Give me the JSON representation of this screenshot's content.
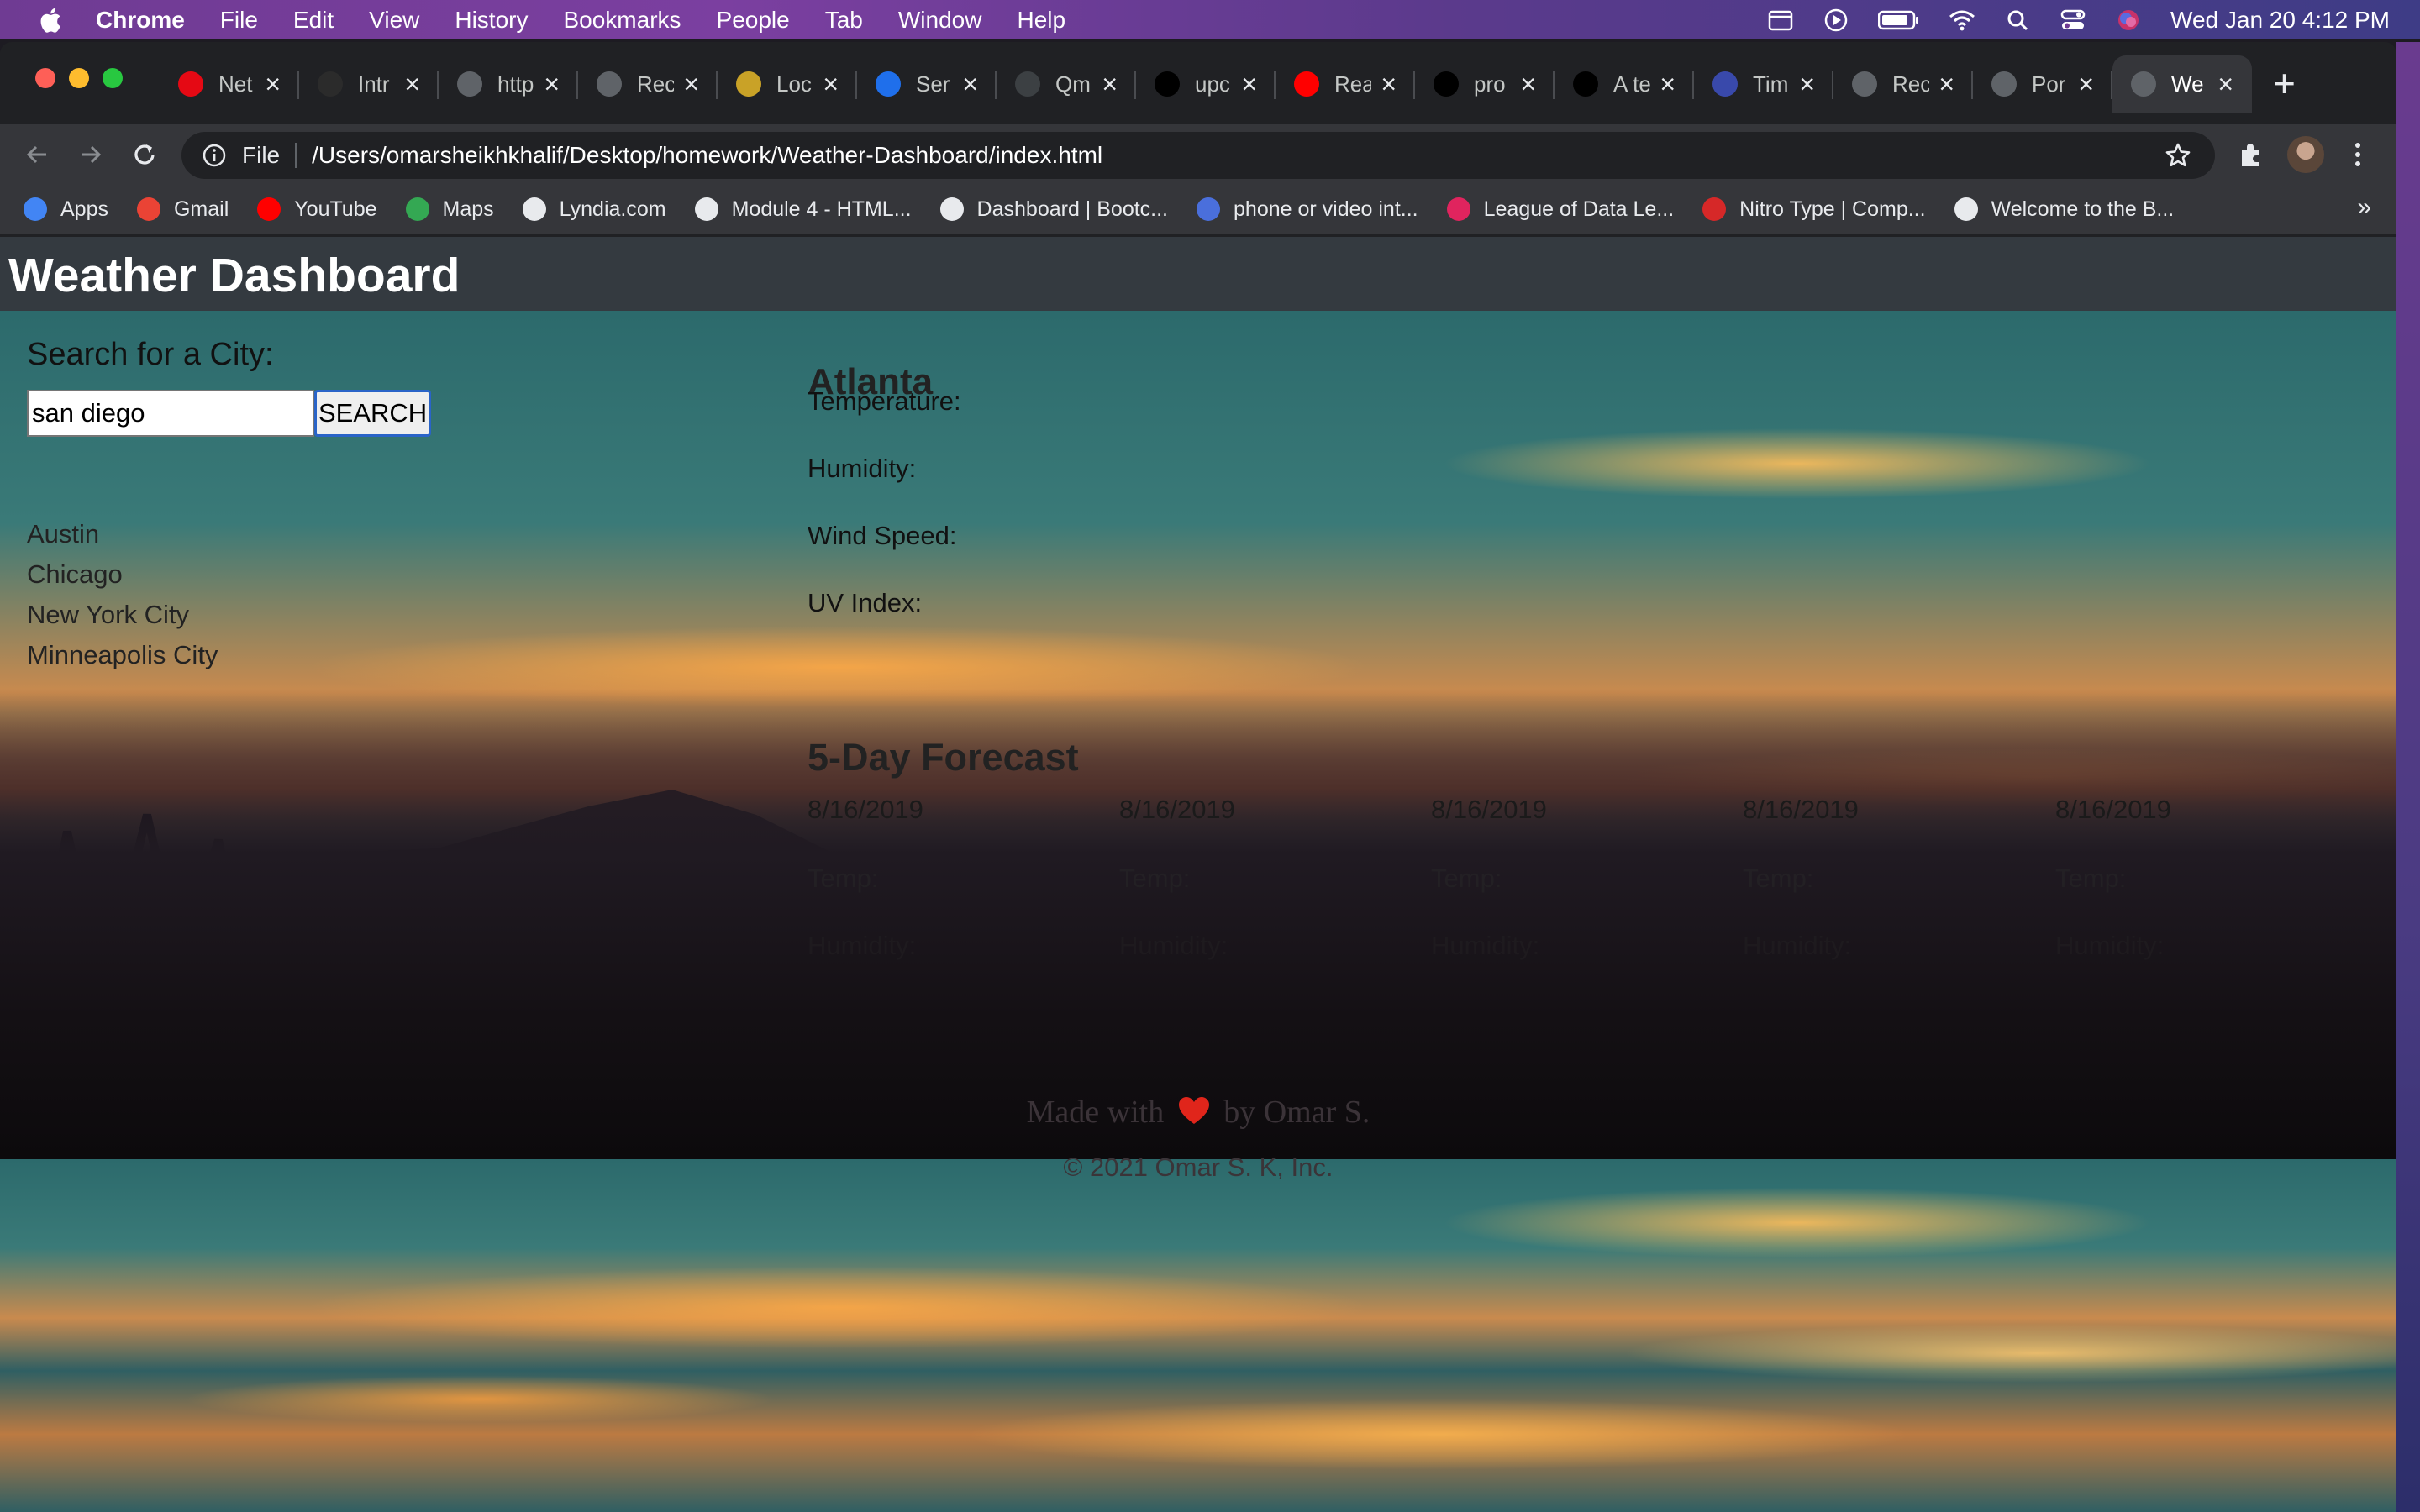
{
  "menubar": {
    "app_name": "Chrome",
    "items": [
      "File",
      "Edit",
      "View",
      "History",
      "Bookmarks",
      "People",
      "Tab",
      "Window",
      "Help"
    ],
    "clock": "Wed Jan 20  4:12 PM",
    "status_icons": [
      "calendar-icon",
      "play-icon",
      "battery-icon",
      "wifi-icon",
      "spotlight-icon",
      "control-center-icon",
      "siri-icon"
    ]
  },
  "tabs": [
    {
      "title": "Net",
      "icon": "netflix-icon",
      "color": "#e50914"
    },
    {
      "title": "Intr",
      "icon": "cs-icon",
      "color": "#2b2b2b"
    },
    {
      "title": "http",
      "icon": "globe-icon",
      "color": "#5f6368"
    },
    {
      "title": "Rec",
      "icon": "globe-icon",
      "color": "#5f6368"
    },
    {
      "title": "Loc",
      "icon": "badge-icon",
      "color": "#c9a227"
    },
    {
      "title": "Ser",
      "icon": "h-icon",
      "color": "#1f6feb"
    },
    {
      "title": "Qm",
      "icon": "q-icon",
      "color": "#3c4043"
    },
    {
      "title": "upc",
      "icon": "github-icon",
      "color": "#000000"
    },
    {
      "title": "Rea",
      "icon": "youtube-icon",
      "color": "#ff0000"
    },
    {
      "title": "pro",
      "icon": "github-icon",
      "color": "#000000"
    },
    {
      "title": "A te",
      "icon": "github-icon",
      "color": "#000000"
    },
    {
      "title": "Tim",
      "icon": "octo-icon",
      "color": "#3949ab"
    },
    {
      "title": "Rec",
      "icon": "globe-icon",
      "color": "#5f6368"
    },
    {
      "title": "Por",
      "icon": "globe-icon",
      "color": "#5f6368"
    },
    {
      "title": "We",
      "icon": "globe-icon",
      "color": "#5f6368",
      "active": true
    }
  ],
  "toolbar": {
    "scheme": "File",
    "url": "/Users/omarsheikhkhalif/Desktop/homework/Weather-Dashboard/index.html"
  },
  "bookmarks": [
    {
      "label": "Apps",
      "icon": "apps-grid-icon",
      "color": "#4285f4"
    },
    {
      "label": "Gmail",
      "icon": "gmail-icon",
      "color": "#ea4335"
    },
    {
      "label": "YouTube",
      "icon": "youtube-icon",
      "color": "#ff0000"
    },
    {
      "label": "Maps",
      "icon": "maps-icon",
      "color": "#34a853"
    },
    {
      "label": "Lyndia.com",
      "icon": "globe-icon",
      "color": "#e8eaed"
    },
    {
      "label": "Module 4 - HTML...",
      "icon": "page-icon",
      "color": "#e8eaed"
    },
    {
      "label": "Dashboard | Bootc...",
      "icon": "globe-icon",
      "color": "#e8eaed"
    },
    {
      "label": "phone or video int...",
      "icon": "video-icon",
      "color": "#4a6fdc"
    },
    {
      "label": "League of Data Le...",
      "icon": "m-logo-icon",
      "color": "#e0245e"
    },
    {
      "label": "Nitro Type | Comp...",
      "icon": "nitro-icon",
      "color": "#d62828"
    },
    {
      "label": "Welcome to the B...",
      "icon": "page-icon",
      "color": "#e8eaed"
    }
  ],
  "page": {
    "title": "Weather Dashboard",
    "search": {
      "label": "Search for a City:",
      "value": "san diego",
      "button": "SEARCH"
    },
    "cities": [
      "Austin",
      "Chicago",
      "New York City",
      "Minneapolis City"
    ],
    "current": {
      "city": "Atlanta",
      "temperature_label": "Temperature:",
      "humidity_label": "Humidity:",
      "wind_label": "Wind Speed:",
      "uv_label": "UV Index:"
    },
    "forecast": {
      "title": "5-Day Forecast",
      "days": [
        {
          "date": "8/16/2019",
          "temp": "Temp:",
          "humidity": "Humidity:"
        },
        {
          "date": "8/16/2019",
          "temp": "Temp:",
          "humidity": "Humidity:"
        },
        {
          "date": "8/16/2019",
          "temp": "Temp:",
          "humidity": "Humidity:"
        },
        {
          "date": "8/16/2019",
          "temp": "Temp:",
          "humidity": "Humidity:"
        },
        {
          "date": "8/16/2019",
          "temp": "Temp:",
          "humidity": "Humidity:"
        }
      ]
    },
    "footer": {
      "made_with": "Made with",
      "by": "by Omar S.",
      "copyright": "© 2021 Omar S. K, Inc."
    }
  }
}
